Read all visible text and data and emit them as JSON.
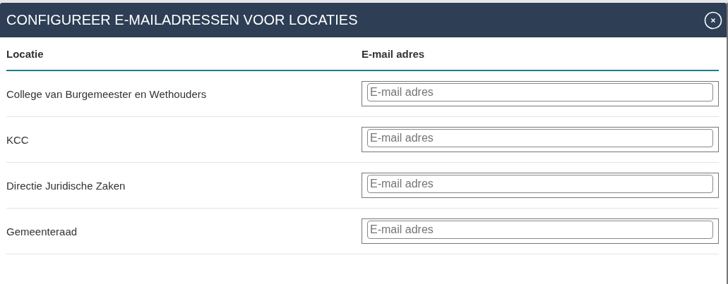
{
  "dialog": {
    "title": "CONFIGUREER E-MAILADRESSEN VOOR LOCATIES"
  },
  "table": {
    "columns": [
      "Locatie",
      "E-mail adres"
    ],
    "rows": [
      {
        "location": "College van Burgemeester en Wethouders",
        "email": {
          "placeholder": "E-mail adres"
        }
      },
      {
        "location": "KCC",
        "email": {
          "placeholder": "E-mail adres"
        }
      },
      {
        "location": "Directie Juridische Zaken",
        "email": {
          "placeholder": "E-mail adres"
        }
      },
      {
        "location": "Gemeenteraad",
        "email": {
          "placeholder": "E-mail adres"
        }
      }
    ]
  }
}
